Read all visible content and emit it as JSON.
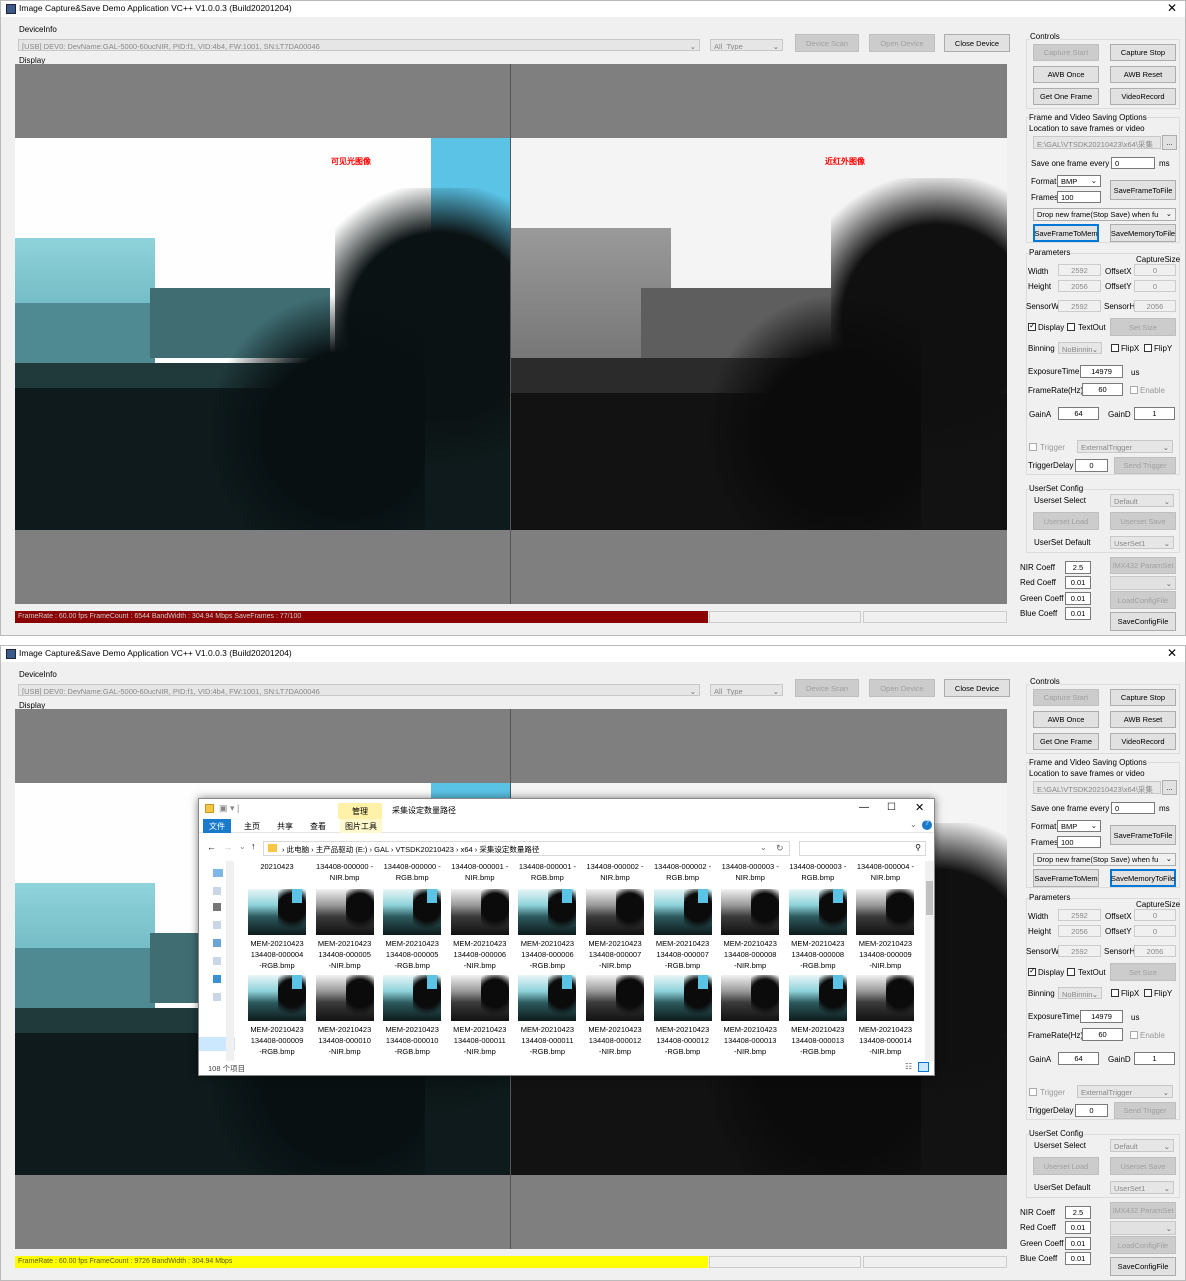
{
  "app": {
    "title": "Image Capture&Save Demo Application VC++ V1.0.0.3 (Build20201204)",
    "close": "✕",
    "deviceinfo_label": "DeviceInfo",
    "device": "[USB] DEV0: DevName:GAL-5000-60ucNIR, PID:f1, VID:4b4, FW:1001, SN:LT7DA00046",
    "type": "All_Type",
    "device_scan": "Device Scan",
    "open_device": "Open Device",
    "close_device": "Close Device",
    "display_label": "Display"
  },
  "captions": {
    "visible": "可见光图像",
    "nir": "近红外图像"
  },
  "controls": {
    "group": "Controls",
    "capture_start": "Capture Start",
    "capture_stop": "Capture Stop",
    "awb_once": "AWB Once",
    "awb_reset": "AWB Reset",
    "get_one_frame": "Get One Frame",
    "video_record": "VideoRecord"
  },
  "saving": {
    "group": "Frame and Video Saving Options",
    "location_label": "Location to save frames or video",
    "path": "E:\\GAL\\VTSDK20210423\\x64\\采集",
    "browse": "...",
    "save_every_label": "Save one frame every",
    "save_every_value": "0",
    "ms": "ms",
    "format_label": "Format",
    "format_value": "BMP",
    "frames_label": "Frames",
    "frames_value": "100",
    "save_to_file": "SaveFrameToFile",
    "drop_option": "Drop new frame(Stop Save) when fu",
    "save_to_mem": "SaveFrameToMem",
    "save_mem_to_file": "SaveMemoryToFile"
  },
  "params": {
    "group": "Parameters",
    "capture_size": "CaptureSize",
    "width_label": "Width",
    "width": "2592",
    "offsetx_label": "OffsetX",
    "offsetx": "0",
    "height_label": "Height",
    "height": "2056",
    "offsety_label": "OffsetY",
    "offsety": "0",
    "sensorw_label": "SensorW",
    "sensorw": "2592",
    "sensorh_label": "SensorH",
    "sensorh": "2056",
    "display_chk": "Display",
    "textout_chk": "TextOut",
    "set_size": "Set Size",
    "binning_label": "Binning",
    "binning": "NoBinnin",
    "flipx": "FlipX",
    "flipy": "FlipY",
    "exposure_label": "ExposureTime",
    "exposure": "14979",
    "us": "us",
    "framerate_label": "FrameRate(Hz)",
    "framerate": "60",
    "enable": "Enable",
    "gaina_label": "GainA",
    "gaina": "64",
    "gaind_label": "GainD",
    "gaind": "1",
    "trigger": "Trigger",
    "trigger_mode": "ExternalTrigger",
    "trigger_delay_label": "TriggerDelay",
    "trigger_delay": "0",
    "send_trigger": "Send Trigger"
  },
  "userset": {
    "group": "UserSet Config",
    "select_label": "Userset Select",
    "select": "Default",
    "load": "Userset Load",
    "save": "Userset Save",
    "default_label": "UserSet Default",
    "default": "UserSet1"
  },
  "coeff": {
    "nir_label": "NIR Coeff",
    "nir": "2.5",
    "red_label": "Red Coeff",
    "red": "0.01",
    "green_label": "Green Coeff",
    "green": "0.01",
    "blue_label": "Blue Coeff",
    "blue": "0.01",
    "imx432": "IMX432 ParamSet",
    "load_config": "LoadConfigFile",
    "save_config": "SaveConfigFile"
  },
  "status": {
    "top": "FrameRate : 60.00 fps FrameCount : 6544 BandWidth : 304.94 Mbps SaveFrames : 77/100",
    "bottom": "FrameRate : 60.00 fps FrameCount : 9726 BandWidth : 304.94 Mbps",
    "top_color": "#8b0000",
    "bottom_color": "#ffff00"
  },
  "explorer": {
    "manage_tab": "管理",
    "title": "采集设定数量路径",
    "file_tab": "文件",
    "home_tab": "主页",
    "share_tab": "共享",
    "view_tab": "查看",
    "pic_tools": "图片工具",
    "crumbs": [
      "此电脑",
      "主产品驱动 (E:)",
      "GAL",
      "VTSDK20210423",
      "x64",
      "采集设定数量路径"
    ],
    "item_count": "108 个项目",
    "top_row": [
      "20210423",
      "134408-000000 -NIR.bmp",
      "134408-000000 -RGB.bmp",
      "134408-000001 -NIR.bmp",
      "134408-000001 -RGB.bmp",
      "134408-000002 -NIR.bmp",
      "134408-000002 -RGB.bmp",
      "134408-000003 -NIR.bmp",
      "134408-000003 -RGB.bmp",
      "134408-000004 -NIR.bmp"
    ],
    "row1": [
      [
        "MEM-20210423",
        "134408-000004",
        "-RGB.bmp",
        "rgb"
      ],
      [
        "MEM-20210423",
        "134408-000005",
        "-NIR.bmp",
        "nir"
      ],
      [
        "MEM-20210423",
        "134408-000005",
        "-RGB.bmp",
        "rgb"
      ],
      [
        "MEM-20210423",
        "134408-000006",
        "-NIR.bmp",
        "nir"
      ],
      [
        "MEM-20210423",
        "134408-000006",
        "-RGB.bmp",
        "rgb"
      ],
      [
        "MEM-20210423",
        "134408-000007",
        "-NIR.bmp",
        "nir"
      ],
      [
        "MEM-20210423",
        "134408-000007",
        "-RGB.bmp",
        "rgb"
      ],
      [
        "MEM-20210423",
        "134408-000008",
        "-NIR.bmp",
        "nir"
      ],
      [
        "MEM-20210423",
        "134408-000008",
        "-RGB.bmp",
        "rgb"
      ],
      [
        "MEM-20210423",
        "134408-000009",
        "-NIR.bmp",
        "nir"
      ]
    ],
    "row2": [
      [
        "MEM-20210423",
        "134408-000009",
        "-RGB.bmp",
        "rgb"
      ],
      [
        "MEM-20210423",
        "134408-000010",
        "-NIR.bmp",
        "nir"
      ],
      [
        "MEM-20210423",
        "134408-000010",
        "-RGB.bmp",
        "rgb"
      ],
      [
        "MEM-20210423",
        "134408-000011",
        "-NIR.bmp",
        "nir"
      ],
      [
        "MEM-20210423",
        "134408-000011",
        "-RGB.bmp",
        "rgb"
      ],
      [
        "MEM-20210423",
        "134408-000012",
        "-NIR.bmp",
        "nir"
      ],
      [
        "MEM-20210423",
        "134408-000012",
        "-RGB.bmp",
        "rgb"
      ],
      [
        "MEM-20210423",
        "134408-000013",
        "-NIR.bmp",
        "nir"
      ],
      [
        "MEM-20210423",
        "134408-000013",
        "-RGB.bmp",
        "rgb"
      ],
      [
        "MEM-20210423",
        "134408-000014",
        "-NIR.bmp",
        "nir"
      ]
    ]
  }
}
